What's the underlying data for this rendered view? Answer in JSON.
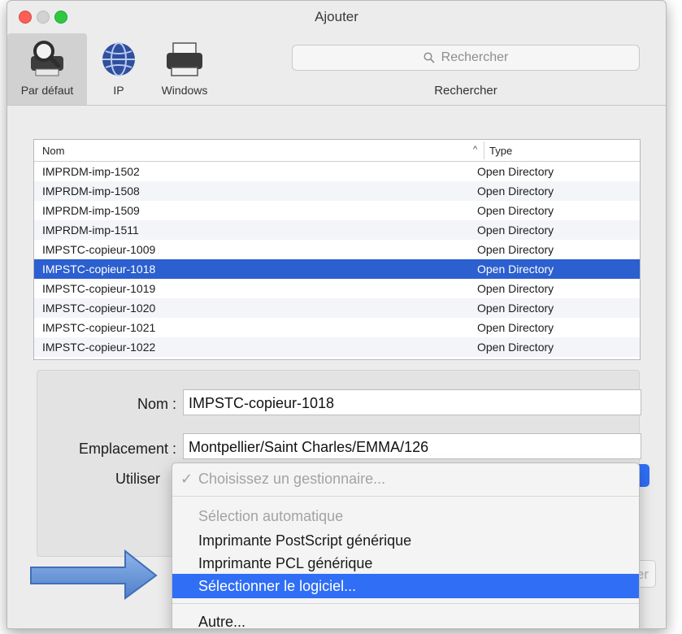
{
  "window": {
    "title": "Ajouter"
  },
  "toolbar": {
    "default_label": "Par défaut",
    "ip_label": "IP",
    "windows_label": "Windows",
    "search_placeholder": "Rechercher",
    "search_label": "Rechercher"
  },
  "list": {
    "col_name": "Nom",
    "col_type": "Type",
    "rows": [
      {
        "name": "IMPRDM-imp-1502",
        "type": "Open Directory"
      },
      {
        "name": "IMPRDM-imp-1508",
        "type": "Open Directory"
      },
      {
        "name": "IMPRDM-imp-1509",
        "type": "Open Directory"
      },
      {
        "name": "IMPRDM-imp-1511",
        "type": "Open Directory"
      },
      {
        "name": "IMPSTC-copieur-1009",
        "type": "Open Directory"
      },
      {
        "name": "IMPSTC-copieur-1018",
        "type": "Open Directory"
      },
      {
        "name": "IMPSTC-copieur-1019",
        "type": "Open Directory"
      },
      {
        "name": "IMPSTC-copieur-1020",
        "type": "Open Directory"
      },
      {
        "name": "IMPSTC-copieur-1021",
        "type": "Open Directory"
      },
      {
        "name": "IMPSTC-copieur-1022",
        "type": "Open Directory"
      }
    ],
    "selected_index": 5
  },
  "form": {
    "name_label": "Nom :",
    "name_value": "IMPSTC-copieur-1018",
    "location_label": "Emplacement :",
    "location_value": "Montpellier/Saint Charles/EMMA/126",
    "use_label": "Utiliser"
  },
  "menu": {
    "check": "✓",
    "items": [
      {
        "label": "Choisissez un gestionnaire..."
      },
      {
        "label": "Sélection automatique"
      },
      {
        "label": "Imprimante PostScript générique"
      },
      {
        "label": "Imprimante PCL générique"
      },
      {
        "label": "Sélectionner le logiciel..."
      },
      {
        "label": "Autre..."
      }
    ]
  },
  "button_partial": "er",
  "colors": {
    "selection": "#2c5fcf",
    "menu_highlight": "#2f6ef5",
    "arrow": "#5b8fd6"
  }
}
